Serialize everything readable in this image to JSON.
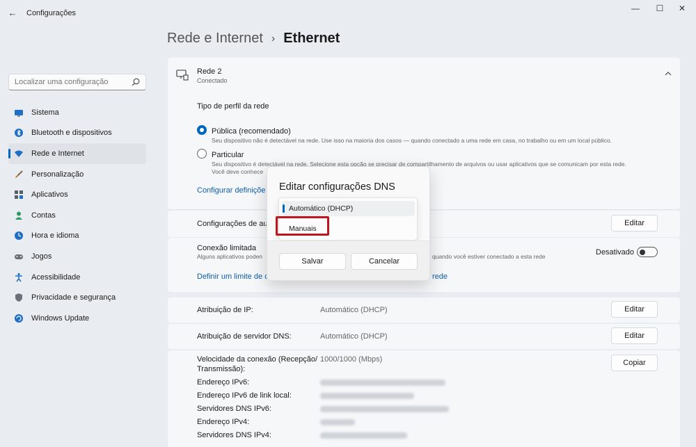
{
  "titlebar": {
    "title": "Configurações",
    "back_icon": "arrow-left-icon",
    "min": "—",
    "max": "☐",
    "close": "✕"
  },
  "search": {
    "placeholder": "Localizar uma configuração",
    "value": ""
  },
  "sidebar": {
    "items": [
      {
        "label": "Sistema",
        "icon": "monitor-icon",
        "color": "#1f6fc5"
      },
      {
        "label": "Bluetooth e dispositivos",
        "icon": "bluetooth-icon",
        "color": "#1f6fc5"
      },
      {
        "label": "Rede e Internet",
        "icon": "wifi-icon",
        "color": "#1f6fc5",
        "active": true
      },
      {
        "label": "Personalização",
        "icon": "brush-icon",
        "color": "#d07a2a"
      },
      {
        "label": "Aplicativos",
        "icon": "apps-icon",
        "color": "#5a5f66"
      },
      {
        "label": "Contas",
        "icon": "person-icon",
        "color": "#2b9a66"
      },
      {
        "label": "Hora e idioma",
        "icon": "clock-globe-icon",
        "color": "#1f6fc5"
      },
      {
        "label": "Jogos",
        "icon": "gamepad-icon",
        "color": "#6b7078"
      },
      {
        "label": "Acessibilidade",
        "icon": "accessibility-icon",
        "color": "#1f6fc5"
      },
      {
        "label": "Privacidade e segurança",
        "icon": "shield-icon",
        "color": "#6b7078"
      },
      {
        "label": "Windows Update",
        "icon": "update-icon",
        "color": "#1f6fc5"
      }
    ]
  },
  "header": {
    "parent": "Rede e Internet",
    "sep": "›",
    "current": "Ethernet"
  },
  "network": {
    "name": "Rede 2",
    "status": "Conectado",
    "profile_title": "Tipo de perfil da rede",
    "public_label": "Pública (recomendado)",
    "public_desc": "Seu dispositivo não é detectável na rede. Use isso na maioria dos casos — quando conectado a uma rede em casa, no trabalho ou em um local público.",
    "private_label": "Particular",
    "private_desc_1": "Seu dispositivo é detectável na rede. Selecione esta opção se precisar de compartilhamento de arquivos ou usar aplicativos que se comunicam por esta rede.",
    "private_desc_2": "Você deve conhece",
    "config_link": "Configurar definiçõe"
  },
  "auth": {
    "label": "Configurações de aut",
    "button": "Editar"
  },
  "metered": {
    "label": "Conexão limitada",
    "desc_left": "Alguns aplicativos poden",
    "desc_right": "quando você estiver conectado a esta rede",
    "state": "Desativado",
    "link_left": "Definir um limite de d",
    "link_right": "rede"
  },
  "ip": {
    "label": "Atribuição de IP:",
    "value": "Automático (DHCP)",
    "button": "Editar"
  },
  "dns": {
    "label": "Atribuição de servidor DNS:",
    "value": "Automático (DHCP)",
    "button": "Editar"
  },
  "props": {
    "speed_label_1": "Velocidade da conexão (Recepção/",
    "speed_label_2": "Transmissão):",
    "speed_value": "1000/1000 (Mbps)",
    "copy_button": "Copiar",
    "ipv6": "Endereço IPv6:",
    "ipv6_link": "Endereço IPv6 de link local:",
    "dns_ipv6": "Servidores DNS IPv6:",
    "ipv4": "Endereço IPv4:",
    "dns_ipv4": "Servidores DNS IPv4:"
  },
  "dialog": {
    "title": "Editar configurações DNS",
    "options": [
      "Automático (DHCP)",
      "Manuais"
    ],
    "save": "Salvar",
    "cancel": "Cancelar"
  },
  "colors": {
    "accent": "#0067c0",
    "highlight": "#c0151f"
  }
}
